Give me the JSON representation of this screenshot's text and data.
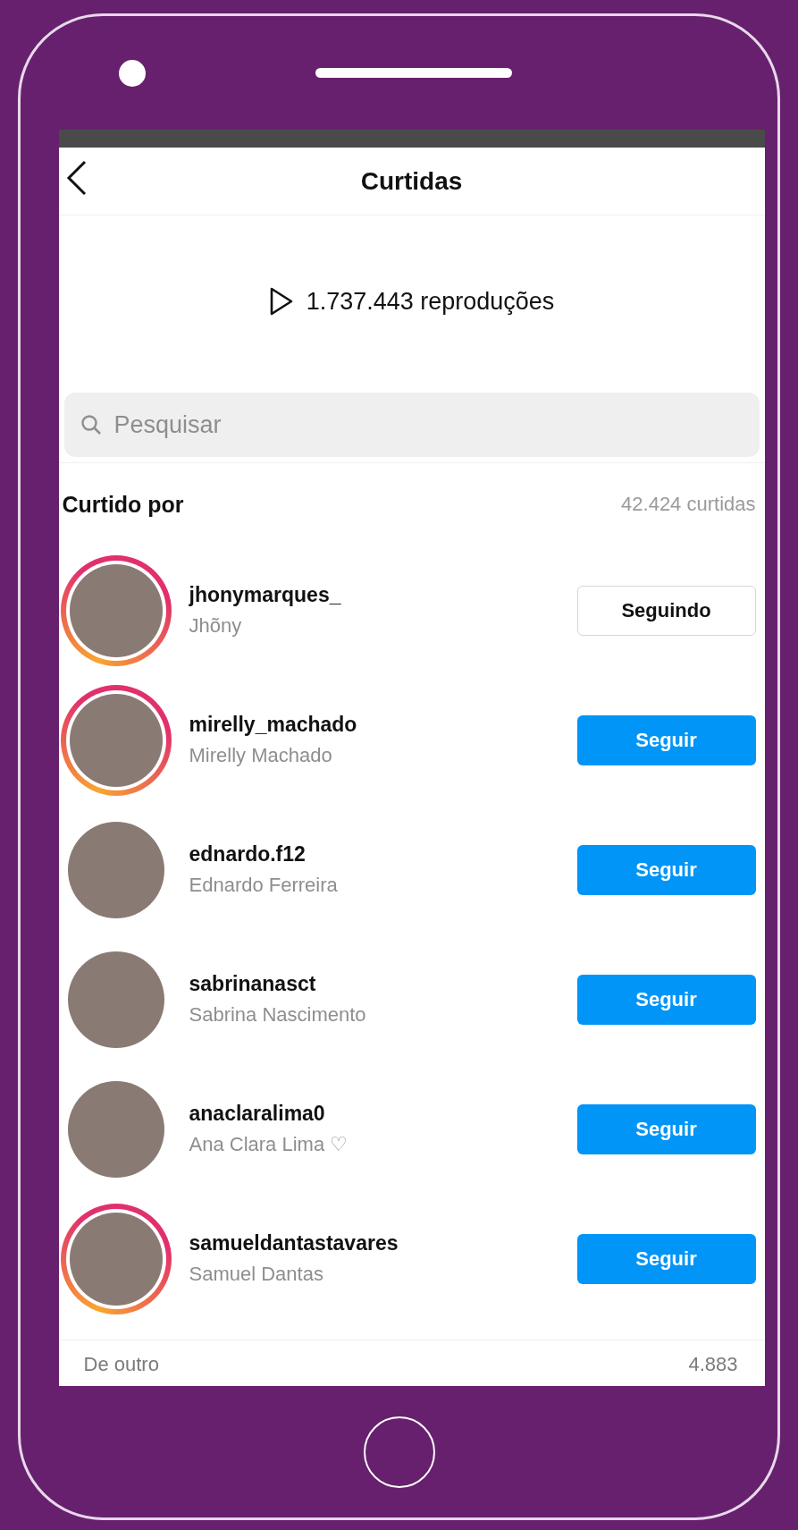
{
  "header": {
    "title": "Curtidas"
  },
  "views": {
    "text": "1.737.443 reproduções"
  },
  "search": {
    "placeholder": "Pesquisar"
  },
  "likes": {
    "heading": "Curtido por",
    "count": "42.424 curtidas"
  },
  "users": [
    {
      "username": "jhonymarques_",
      "name": "Jhõny",
      "story_ring": true,
      "following": true,
      "button": "Seguindo"
    },
    {
      "username": "mirelly_machado",
      "name": "Mirelly Machado",
      "story_ring": true,
      "following": false,
      "button": "Seguir"
    },
    {
      "username": "ednardo.f12",
      "name": "Ednardo Ferreira",
      "story_ring": false,
      "following": false,
      "button": "Seguir"
    },
    {
      "username": "sabrinanasct",
      "name": "Sabrina Nascimento",
      "story_ring": false,
      "following": false,
      "button": "Seguir"
    },
    {
      "username": "anaclaralima0",
      "name": "Ana Clara Lima ♡",
      "story_ring": false,
      "following": false,
      "button": "Seguir"
    },
    {
      "username": "samueldantastavares",
      "name": "Samuel Dantas",
      "story_ring": true,
      "following": false,
      "button": "Seguir"
    }
  ],
  "breakdown": [
    {
      "label": "De outro",
      "value": "4.883"
    }
  ]
}
